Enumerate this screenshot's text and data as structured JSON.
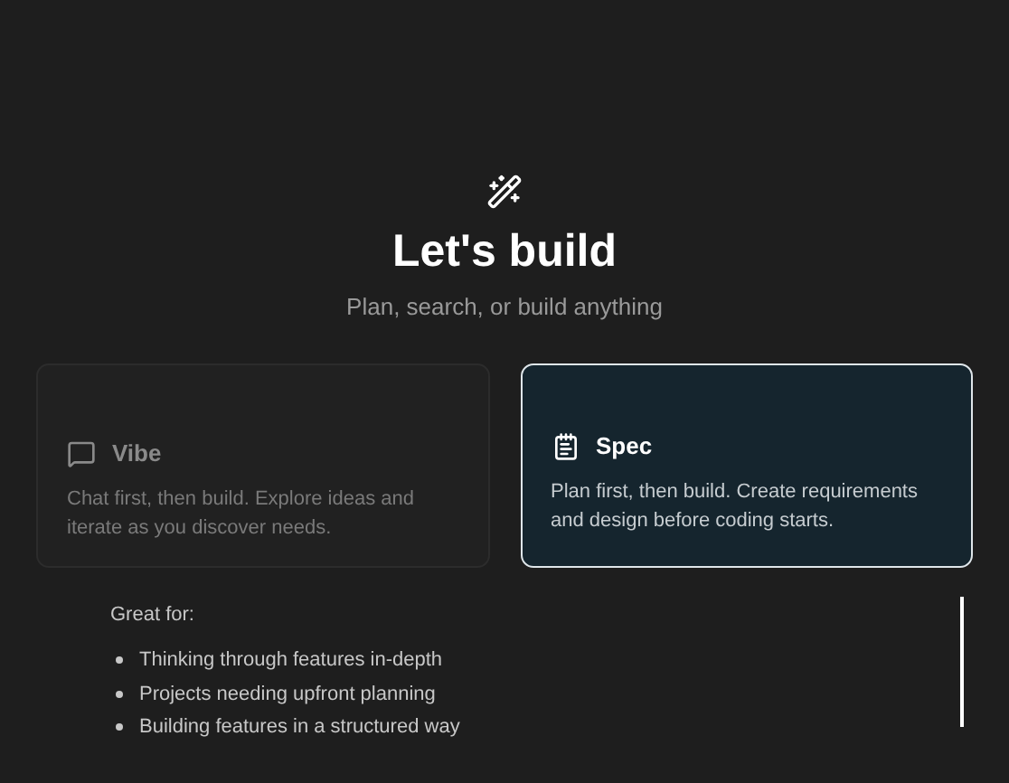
{
  "header": {
    "title": "Let's build",
    "subtitle": "Plan, search, or build anything"
  },
  "modes": [
    {
      "kind": "chat",
      "title": "Vibe",
      "description": "Chat first, then build. Explore ideas and iterate as you discover needs.",
      "selected": false
    },
    {
      "kind": "spec",
      "title": "Spec",
      "description": "Plan first, then build. Create requirements and design before coding starts.",
      "selected": true
    }
  ],
  "details": {
    "heading": "Great for:",
    "items": [
      "Thinking through features in-depth",
      "Projects needing upfront planning",
      "Building features in a structured way"
    ]
  }
}
